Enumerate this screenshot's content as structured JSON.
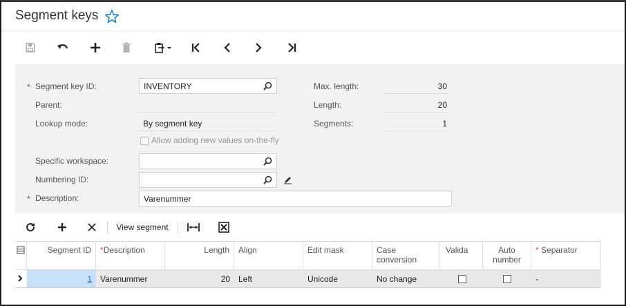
{
  "header": {
    "title": "Segment keys",
    "favorite_icon": "star-outline-icon"
  },
  "toolbar": {
    "buttons": [
      "save-icon",
      "undo-icon",
      "add-icon",
      "delete-icon",
      "clipboard-icon",
      "first-icon",
      "prev-icon",
      "next-icon",
      "last-icon"
    ]
  },
  "form": {
    "segment_key_id": {
      "label": "Segment key ID:",
      "value": "INVENTORY",
      "required": "*"
    },
    "parent": {
      "label": "Parent:",
      "value": ""
    },
    "lookup_mode": {
      "label": "Lookup mode:",
      "value": "By segment key"
    },
    "allow_new_values": {
      "label": "Allow adding new values on-the-fly",
      "checked": false
    },
    "specific_workspace": {
      "label": "Specific workspace:",
      "value": ""
    },
    "numbering_id": {
      "label": "Numbering ID:",
      "value": ""
    },
    "description": {
      "label": "Description:",
      "value": "Varenummer",
      "required": "*"
    },
    "max_length": {
      "label": "Max. length:",
      "value": "30"
    },
    "length": {
      "label": "Length:",
      "value": "20"
    },
    "segments": {
      "label": "Segments:",
      "value": "1"
    }
  },
  "grid_toolbar": {
    "refresh_icon": "refresh-icon",
    "add_icon": "add-icon",
    "delete_icon": "close-icon",
    "view_segment": "View segment",
    "fit_icon": "fit-width-icon",
    "export_icon": "excel-export-icon"
  },
  "grid": {
    "columns": [
      {
        "label": "Segment ID",
        "required": ""
      },
      {
        "label": "Description",
        "required": "*"
      },
      {
        "label": "Length",
        "required": ""
      },
      {
        "label": "Align",
        "required": ""
      },
      {
        "label": "Edit mask",
        "required": ""
      },
      {
        "label": "Case conversion",
        "required": ""
      },
      {
        "label": "Valida",
        "required": ""
      },
      {
        "label": "Auto number",
        "required": ""
      },
      {
        "label": "Separator",
        "required": "*"
      }
    ],
    "rows": [
      {
        "segment_id": "1",
        "description": "Varenummer",
        "length": "20",
        "align": "Left",
        "edit_mask": "Unicode",
        "case_conversion": "No change",
        "validate": false,
        "auto_number": false,
        "separator": "-"
      }
    ]
  },
  "colors": {
    "accent": "#1a7bd3",
    "selected_cell": "#c7dff7",
    "form_bg": "#f2f2f2"
  }
}
